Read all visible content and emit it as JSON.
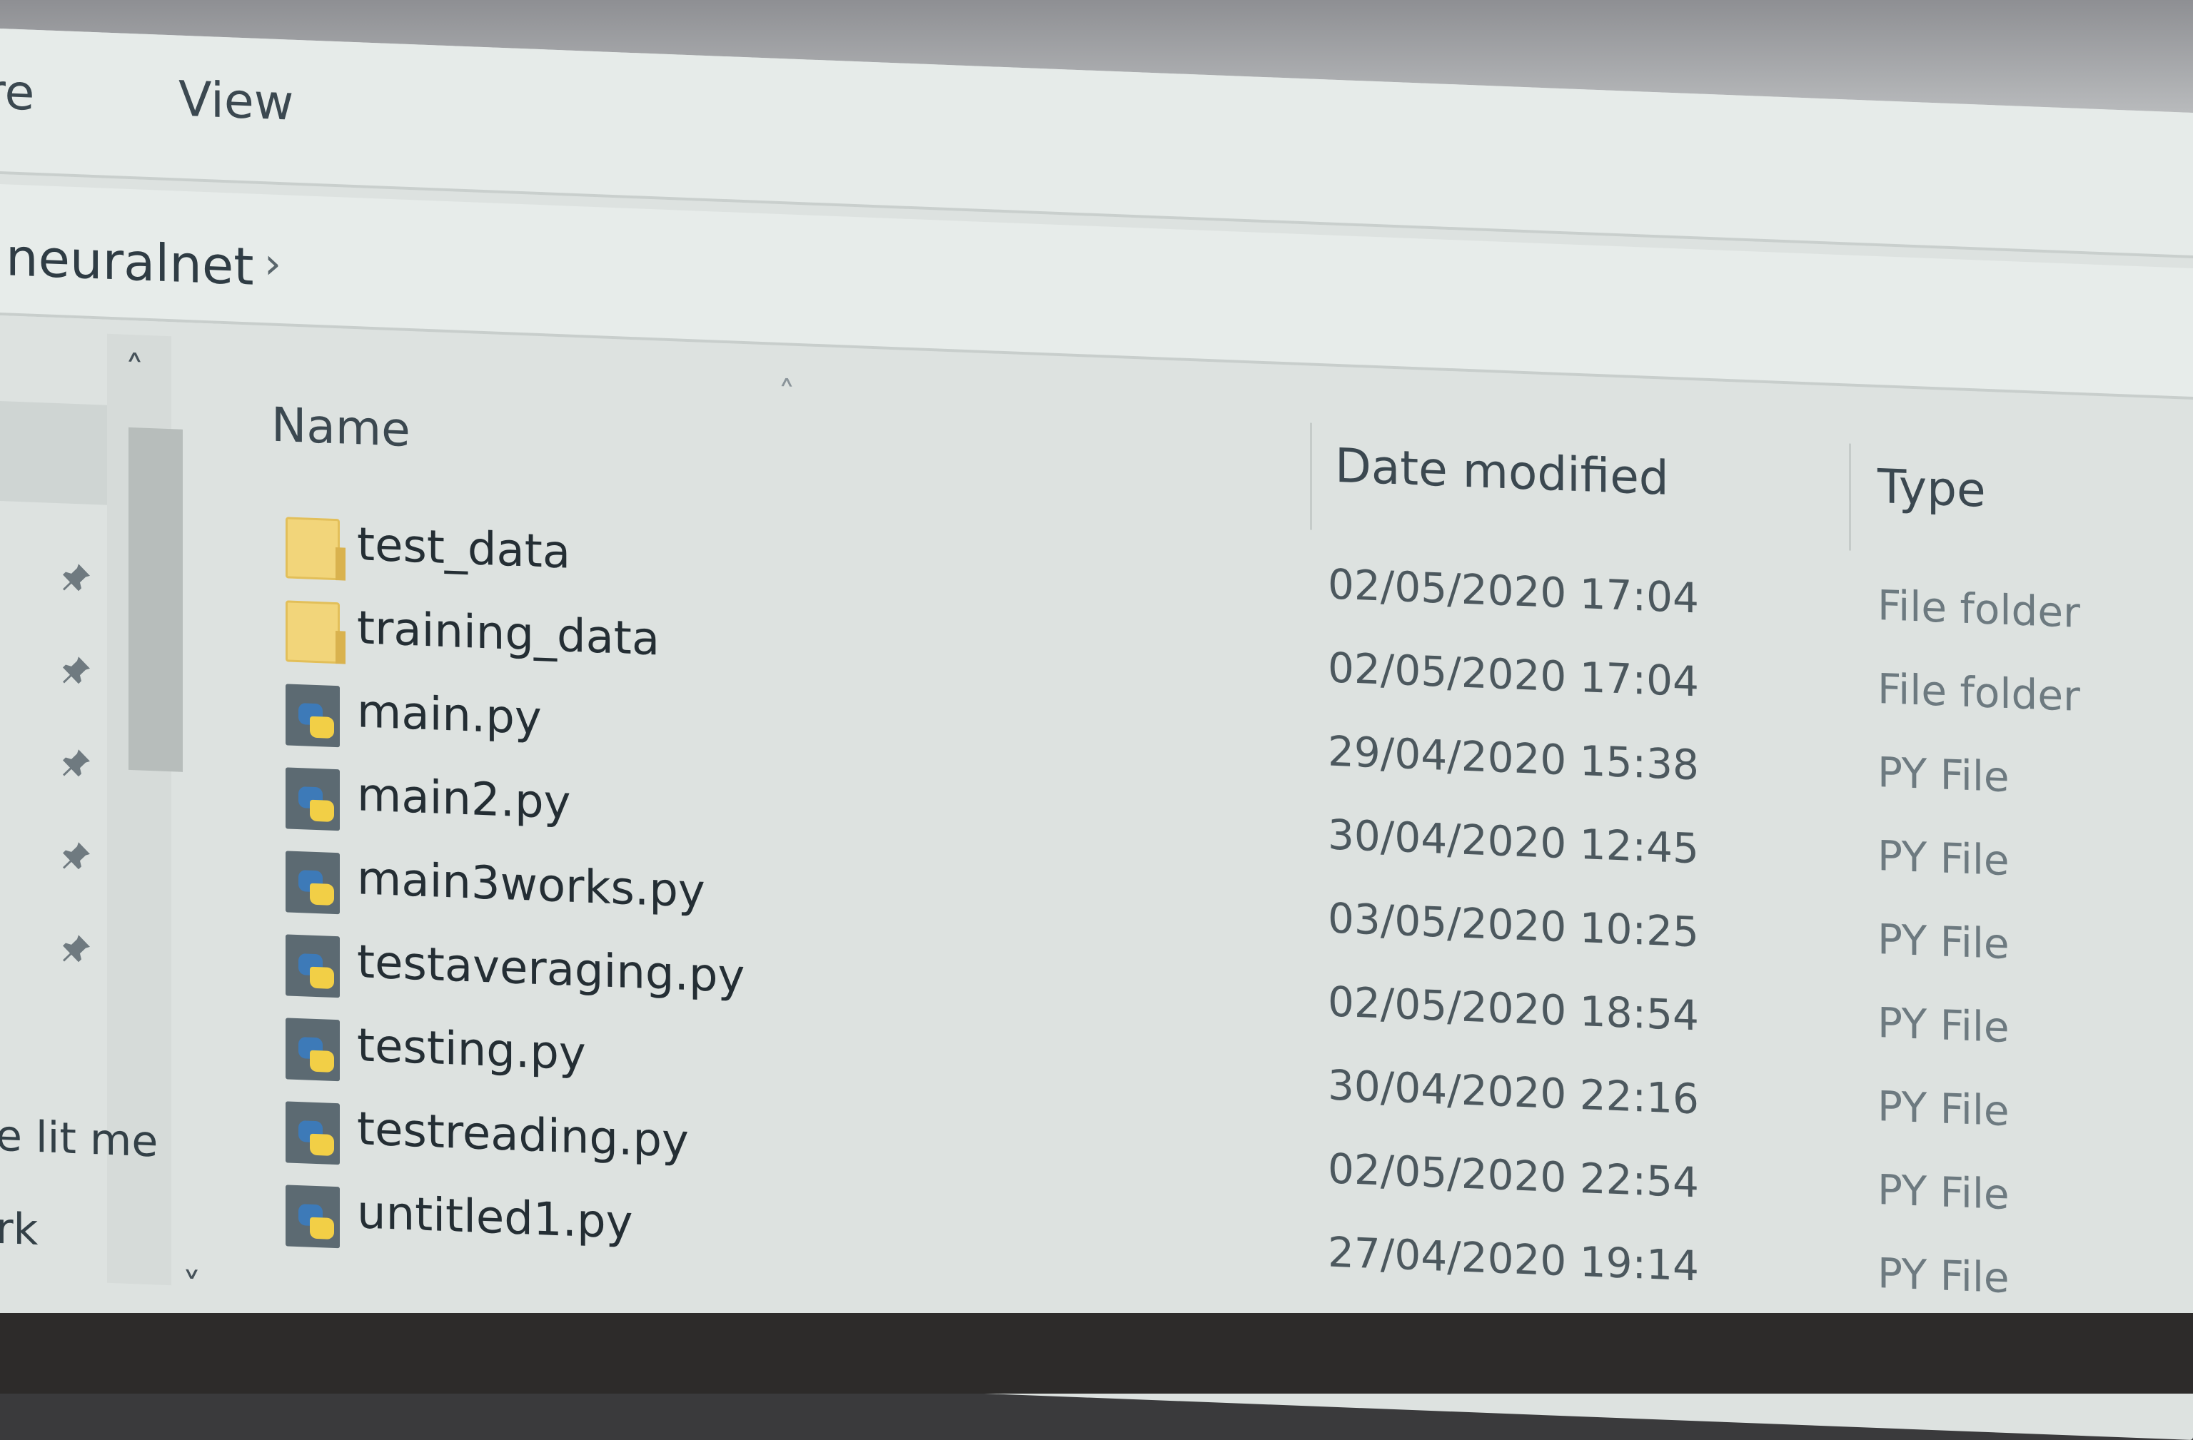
{
  "ribbon": {
    "tabs": [
      {
        "label": "re"
      },
      {
        "label": "View"
      }
    ]
  },
  "address_bar": {
    "crumb": "neuralnet",
    "chevron": "›"
  },
  "nav_pane": {
    "scroll_up": "˄",
    "scroll_down": "˅",
    "pin_glyph": "📌",
    "items": [
      {
        "label": "e lit me"
      },
      {
        "label": "rk"
      }
    ]
  },
  "file_list": {
    "sort_glyph": "˄",
    "headers": {
      "name": "Name",
      "date": "Date modified",
      "type": "Type"
    },
    "rows": [
      {
        "name": "test_data",
        "date": "02/05/2020 17:04",
        "type": "File folder",
        "icon": "folder-icon"
      },
      {
        "name": "training_data",
        "date": "02/05/2020 17:04",
        "type": "File folder",
        "icon": "folder-icon"
      },
      {
        "name": "main.py",
        "date": "29/04/2020 15:38",
        "type": "PY File",
        "icon": "python-file-icon"
      },
      {
        "name": "main2.py",
        "date": "30/04/2020 12:45",
        "type": "PY File",
        "icon": "python-file-icon"
      },
      {
        "name": "main3works.py",
        "date": "03/05/2020 10:25",
        "type": "PY File",
        "icon": "python-file-icon"
      },
      {
        "name": "testaveraging.py",
        "date": "02/05/2020 18:54",
        "type": "PY File",
        "icon": "python-file-icon"
      },
      {
        "name": "testing.py",
        "date": "30/04/2020 22:16",
        "type": "PY File",
        "icon": "python-file-icon"
      },
      {
        "name": "testreading.py",
        "date": "02/05/2020 22:54",
        "type": "PY File",
        "icon": "python-file-icon"
      },
      {
        "name": "untitled1.py",
        "date": "27/04/2020 19:14",
        "type": "PY File",
        "icon": "python-file-icon"
      }
    ]
  },
  "colors": {
    "window_bg": "#dde2e0",
    "folder": "#f2d57a",
    "python_blue": "#3d7ab8",
    "python_yellow": "#f2cf46"
  }
}
